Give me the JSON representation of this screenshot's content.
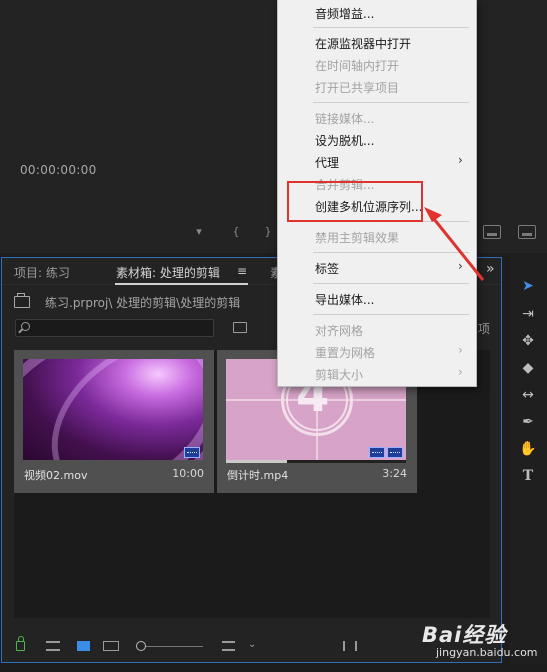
{
  "monitor": {
    "timecode": "00:00:00:00"
  },
  "project_panel": {
    "tabs": [
      {
        "label": "项目: 练习"
      },
      {
        "label": "素材箱: 处理的剪辑"
      },
      {
        "label": "素"
      }
    ],
    "tab_menu_icon": "hamburger-icon",
    "overflow_icon": "double-chevron-right-icon",
    "path": "练习.prproj\\ 处理的剪辑\\处理的剪辑",
    "search": {
      "value": "",
      "placeholder": ""
    },
    "column_fragment": "项",
    "clips": [
      {
        "name": "视频02.mov",
        "duration": "10:00"
      },
      {
        "name": "倒计时.mp4",
        "duration": "3:24",
        "leader_number": "4",
        "playhead_progress": 0.34
      }
    ],
    "bottom_icons": [
      "lock-icon",
      "list-view-icon",
      "icon-view-icon",
      "freeform-view-icon",
      "zoom-slider",
      "sort-icon",
      "automate-icon",
      "find-icon",
      "new-bin-icon",
      "new-item-icon",
      "clear-icon"
    ]
  },
  "tools": [
    "selection-tool",
    "track-select-tool",
    "ripple-edit-tool",
    "razor-tool",
    "slip-tool",
    "pen-tool",
    "hand-tool",
    "type-tool"
  ],
  "context_menu": {
    "items": [
      {
        "label": "音频增益...",
        "enabled": true
      },
      {
        "label": "在源监视器中打开",
        "enabled": true
      },
      {
        "label": "在时间轴内打开",
        "enabled": false
      },
      {
        "label": "打开已共享项目",
        "enabled": false
      },
      {
        "label": "链接媒体...",
        "enabled": false
      },
      {
        "label": "设为脱机...",
        "enabled": true
      },
      {
        "label": "代理",
        "enabled": true,
        "submenu": true
      },
      {
        "label": "合并剪辑...",
        "enabled": false
      },
      {
        "label": "创建多机位源序列...",
        "enabled": true,
        "highlighted": true
      },
      {
        "label": "禁用主剪辑效果",
        "enabled": false
      },
      {
        "label": "标签",
        "enabled": true,
        "submenu": true
      },
      {
        "label": "导出媒体...",
        "enabled": true
      },
      {
        "label": "对齐网格",
        "enabled": false
      },
      {
        "label": "重置为网格",
        "enabled": false,
        "submenu": true
      },
      {
        "label": "剪辑大小",
        "enabled": false,
        "submenu": true
      }
    ]
  },
  "annotation": {
    "color": "#e0322e"
  },
  "watermark": {
    "brand": "Bai经验",
    "url": "jingyan.baidu.com"
  },
  "colors": {
    "accent": "#3d8fe8",
    "panel_border": "#2f6fb5",
    "lock_green": "#4fb34f"
  }
}
